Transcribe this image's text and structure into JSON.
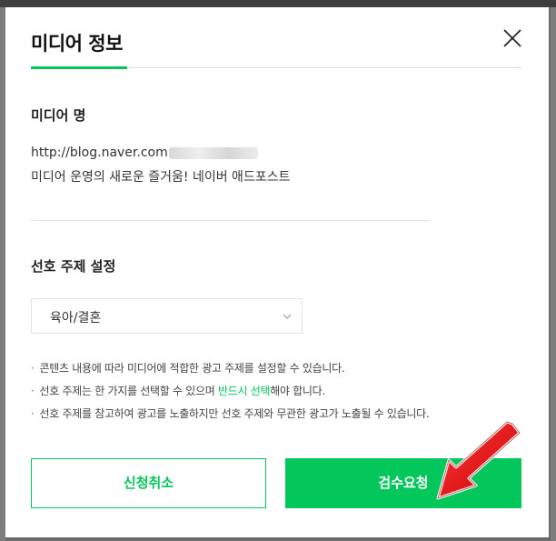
{
  "modal": {
    "title": "미디어 정보",
    "close_icon": "close-icon"
  },
  "media": {
    "label": "미디어 명",
    "url_visible": "http://blog.naver.com",
    "description": "미디어 운영의 새로운 즐거움! 네이버 애드포스트"
  },
  "topic": {
    "label": "선호 주제 설정",
    "selected": "육아/결혼",
    "arrow_icon": "chevron-down-icon"
  },
  "notes": [
    {
      "before": "콘텐츠 내용에 따라 미디어에 적합한 광고 주제를 설정할 수 있습니다.",
      "highlight": "",
      "after": ""
    },
    {
      "before": "선호 주제는 한 가지를 선택할 수 있으며 ",
      "highlight": "반드시 선택",
      "after": "해야 합니다."
    },
    {
      "before": "선호 주제를 참고하여 광고를 노출하지만 선호 주제와 무관한 광고가 노출될 수 있습니다.",
      "highlight": "",
      "after": ""
    }
  ],
  "notes_bullet": "·",
  "buttons": {
    "cancel": "신청취소",
    "submit": "검수요청"
  },
  "colors": {
    "accent": "#03c75a",
    "annotation_arrow": "#e30613"
  }
}
